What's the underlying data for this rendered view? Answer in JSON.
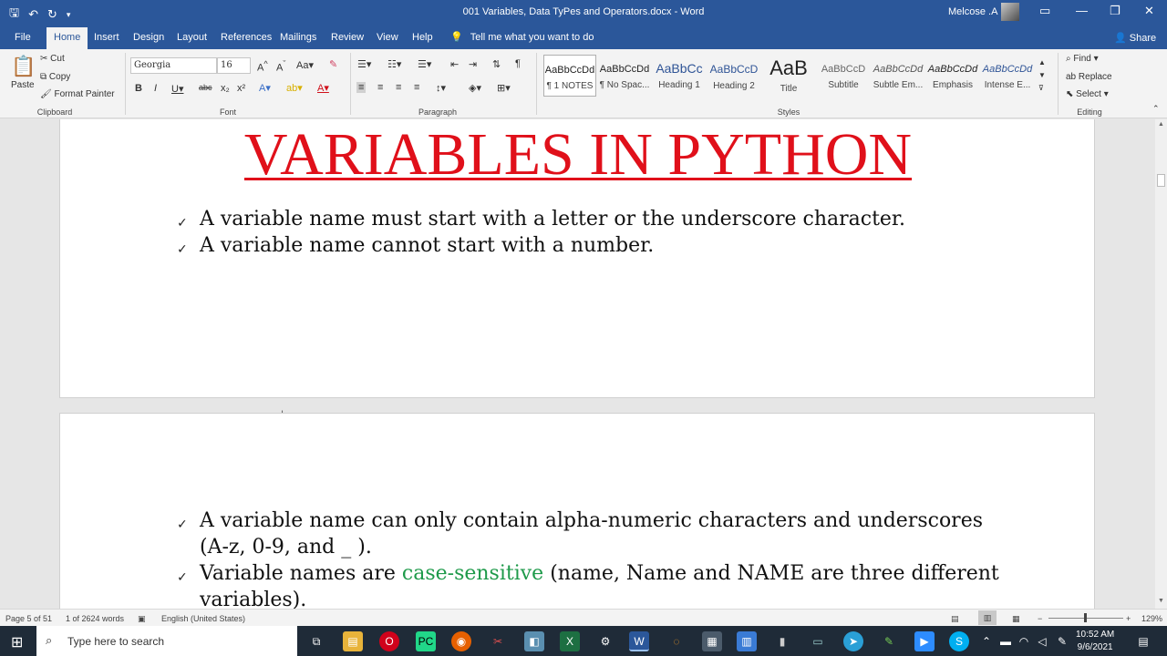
{
  "titlebar": {
    "doc_title": "001 Variables, Data TyPes and Operators.docx  -  Word",
    "user": "Melcose .A"
  },
  "tabs": [
    "File",
    "Home",
    "Insert",
    "Design",
    "Layout",
    "References",
    "Mailings",
    "Review",
    "View",
    "Help"
  ],
  "tell_me": "Tell me what you want to do",
  "share": "Share",
  "clipboard": {
    "paste": "Paste",
    "cut": "Cut",
    "copy": "Copy",
    "format_painter": "Format Painter",
    "label": "Clipboard"
  },
  "font": {
    "name": "Georgia",
    "size": "16",
    "label": "Font"
  },
  "paragraph": {
    "label": "Paragraph"
  },
  "styles": {
    "label": "Styles",
    "items": [
      {
        "preview": "AaBbCcDd",
        "name": "¶ 1 NOTES"
      },
      {
        "preview": "AaBbCcDd",
        "name": "¶ No Spac..."
      },
      {
        "preview": "AaBbCc",
        "name": "Heading 1"
      },
      {
        "preview": "AaBbCcD",
        "name": "Heading 2"
      },
      {
        "preview": "AaB",
        "name": "Title"
      },
      {
        "preview": "AaBbCcD",
        "name": "Subtitle"
      },
      {
        "preview": "AaBbCcDd",
        "name": "Subtle Em..."
      },
      {
        "preview": "AaBbCcDd",
        "name": "Emphasis"
      },
      {
        "preview": "AaBbCcDd",
        "name": "Intense E..."
      }
    ]
  },
  "editing": {
    "find": "Find",
    "replace": "Replace",
    "select": "Select",
    "label": "Editing"
  },
  "document": {
    "heading": "VARIABLES IN PYTHON",
    "bullets_page1": [
      "A variable name must start with a letter or the underscore character.",
      "A variable name cannot start with a number."
    ],
    "bullet3_line1": "A variable name can only contain alpha-numeric characters and underscores",
    "bullet3_line2": "(A-z, 0-9, and _ ).",
    "bullet4_pre": "Variable names are ",
    "bullet4_highlight": "case-sensitive",
    "bullet4_post": " (name, Name and NAME are three different",
    "bullet4_line2": "variables)."
  },
  "status": {
    "page": "Page 5 of 51",
    "words": "1 of 2624 words",
    "language": "English (United States)",
    "zoom": "129%"
  },
  "taskbar": {
    "search_placeholder": "Type here to search",
    "time": "10:52 AM",
    "date": "9/6/2021"
  },
  "colors": {
    "word_blue": "#2b579a",
    "heading_red": "#e0101a",
    "highlight_green": "#1e9a4a"
  }
}
